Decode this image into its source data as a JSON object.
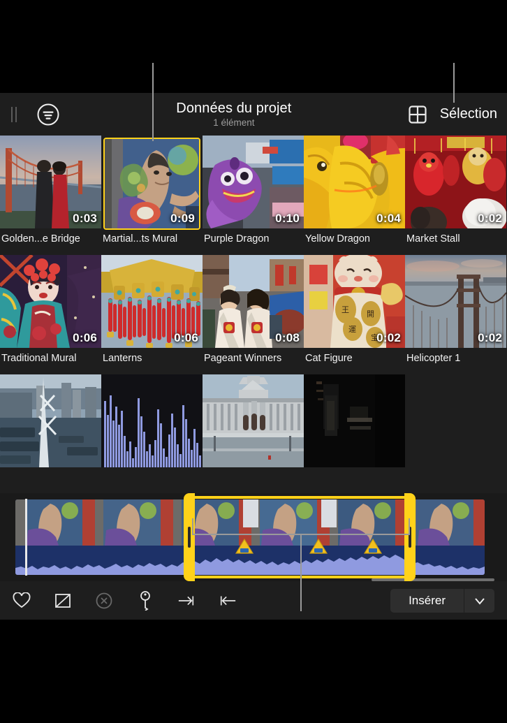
{
  "window": {
    "background": "#000000",
    "panel_bg": "#1e1e1e",
    "accent": "#ffd21a"
  },
  "toolbar": {
    "pause_icon": "pause-icon",
    "filter_icon": "filter-circle-icon",
    "title": "Données du projet",
    "subtitle": "1 élément",
    "grid_icon": "grid-view-icon",
    "selection_label": "Sélection"
  },
  "clips": [
    {
      "name": "Golden...e Bridge",
      "duration": "0:03",
      "selected": false,
      "art": "golden-gate-couple"
    },
    {
      "name": "Martial...ts Mural",
      "duration": "0:09",
      "selected": true,
      "art": "martial-arts-mural"
    },
    {
      "name": "Purple Dragon",
      "duration": "0:10",
      "selected": false,
      "art": "purple-dragon"
    },
    {
      "name": "Yellow Dragon",
      "duration": "0:04",
      "selected": false,
      "art": "yellow-dragon"
    },
    {
      "name": "Market Stall",
      "duration": "0:02",
      "selected": false,
      "art": "market-stall"
    },
    {
      "name": "Traditional Mural",
      "duration": "0:06",
      "selected": false,
      "art": "traditional-mural"
    },
    {
      "name": "Lanterns",
      "duration": "0:06",
      "selected": false,
      "art": "lanterns"
    },
    {
      "name": "Pageant Winners",
      "duration": "0:08",
      "selected": false,
      "art": "pageant-winners"
    },
    {
      "name": "Cat Figure",
      "duration": "0:02",
      "selected": false,
      "art": "cat-figure"
    },
    {
      "name": "Helicopter 1",
      "duration": "0:02",
      "selected": false,
      "art": "helicopter-bridge"
    }
  ],
  "clips_partial": [
    {
      "name": "",
      "duration": "",
      "art": "bay-bridge-aerial"
    },
    {
      "name": "",
      "duration": "",
      "art": "audio-waveform"
    },
    {
      "name": "",
      "duration": "",
      "art": "city-hall"
    },
    {
      "name": "",
      "duration": "",
      "art": "dark-interior"
    }
  ],
  "timeline": {
    "clip_art": "martial-arts-mural-filmstrip",
    "playhead_label": "playhead",
    "selection_start_handle": "trim-start-handle",
    "selection_end_handle": "trim-end-handle",
    "markers": 3
  },
  "bottom_tools": [
    {
      "icon": "heart-icon",
      "name": "favorite-button",
      "dim": false
    },
    {
      "icon": "reject-icon",
      "name": "reject-button",
      "dim": false
    },
    {
      "icon": "unrate-icon",
      "name": "unrate-button",
      "dim": true
    },
    {
      "icon": "key-icon",
      "name": "keyword-button",
      "dim": false
    },
    {
      "icon": "arrow-to-end-icon",
      "name": "set-start-button",
      "dim": false
    },
    {
      "icon": "arrow-to-start-icon",
      "name": "set-end-button",
      "dim": false
    }
  ],
  "insert": {
    "label": "Insérer",
    "menu_icon": "chevron-down-icon"
  }
}
